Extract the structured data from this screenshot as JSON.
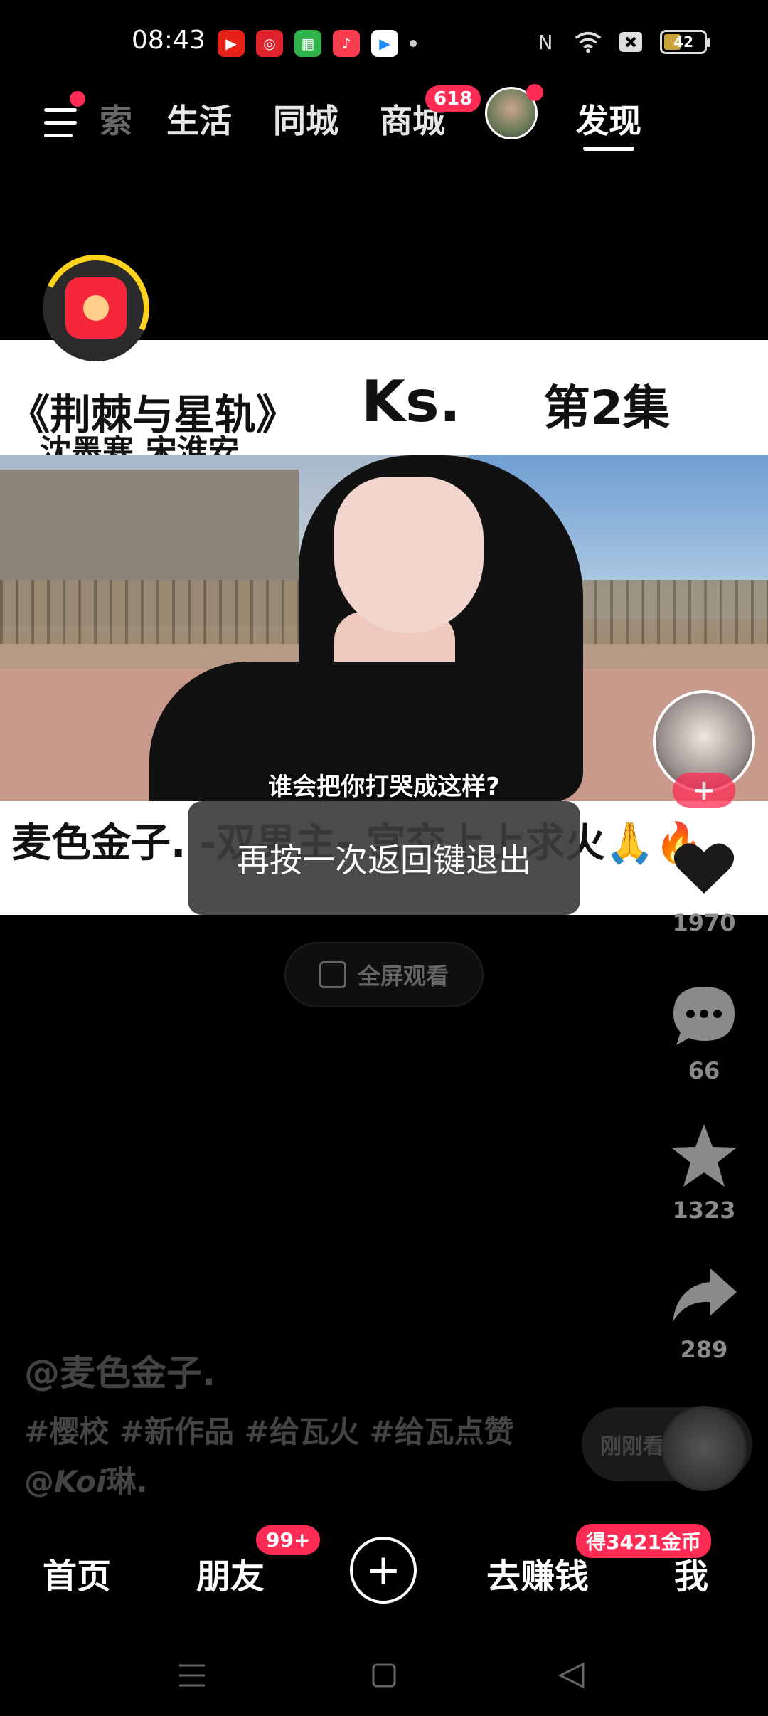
{
  "status_bar": {
    "time": "08:43",
    "battery": "42",
    "battery_level": 0.42,
    "app_icons": [
      "youtube-music-icon",
      "netease-icon",
      "app-icon-green",
      "music-icon",
      "video-app-icon"
    ],
    "right_icons": [
      "nfc-icon",
      "wifi-icon",
      "sim-off-icon",
      "battery-icon"
    ]
  },
  "top_nav": {
    "tabs": [
      {
        "label": "索"
      },
      {
        "label": "生活"
      },
      {
        "label": "同城"
      },
      {
        "label": "商城"
      },
      {
        "label": "发现"
      }
    ],
    "mall_badge": "618",
    "active_tab": "发现"
  },
  "video": {
    "title_left": "《荆棘与星轨》",
    "title_sub": "沈墨寒.宋淮安",
    "title_ks": "Ks.",
    "episode": "第2集",
    "subtitle": "谁会把你打哭成这样?",
    "bottom_text": "麦色金子.  -双男主-  宫交上上求火🙏🔥"
  },
  "toast": {
    "text": "再按一次返回键退出"
  },
  "fullscreen": {
    "label": "全屏观看"
  },
  "actions": {
    "likes": "1970",
    "comments": "66",
    "favorites": "1323",
    "shares": "289"
  },
  "caption": {
    "author": "@麦色金子.",
    "tags_line1": "#樱校 #新作品 #给瓦火 #给瓦点赞",
    "mention_prefix": "@",
    "mention_bold": "Koi",
    "mention_suffix": "琳."
  },
  "recently_viewed": {
    "label": "刚刚看过"
  },
  "bottom_nav": {
    "home": "首页",
    "friends": "朋友",
    "friends_badge": "99+",
    "plus": "+",
    "earn": "去赚钱",
    "earn_badge": "得3421金币",
    "me": "我"
  },
  "colors": {
    "accent": "#fe2c55",
    "background": "#000000",
    "toast": "#3c3c3c",
    "progress_ring": "#ffd21e"
  }
}
